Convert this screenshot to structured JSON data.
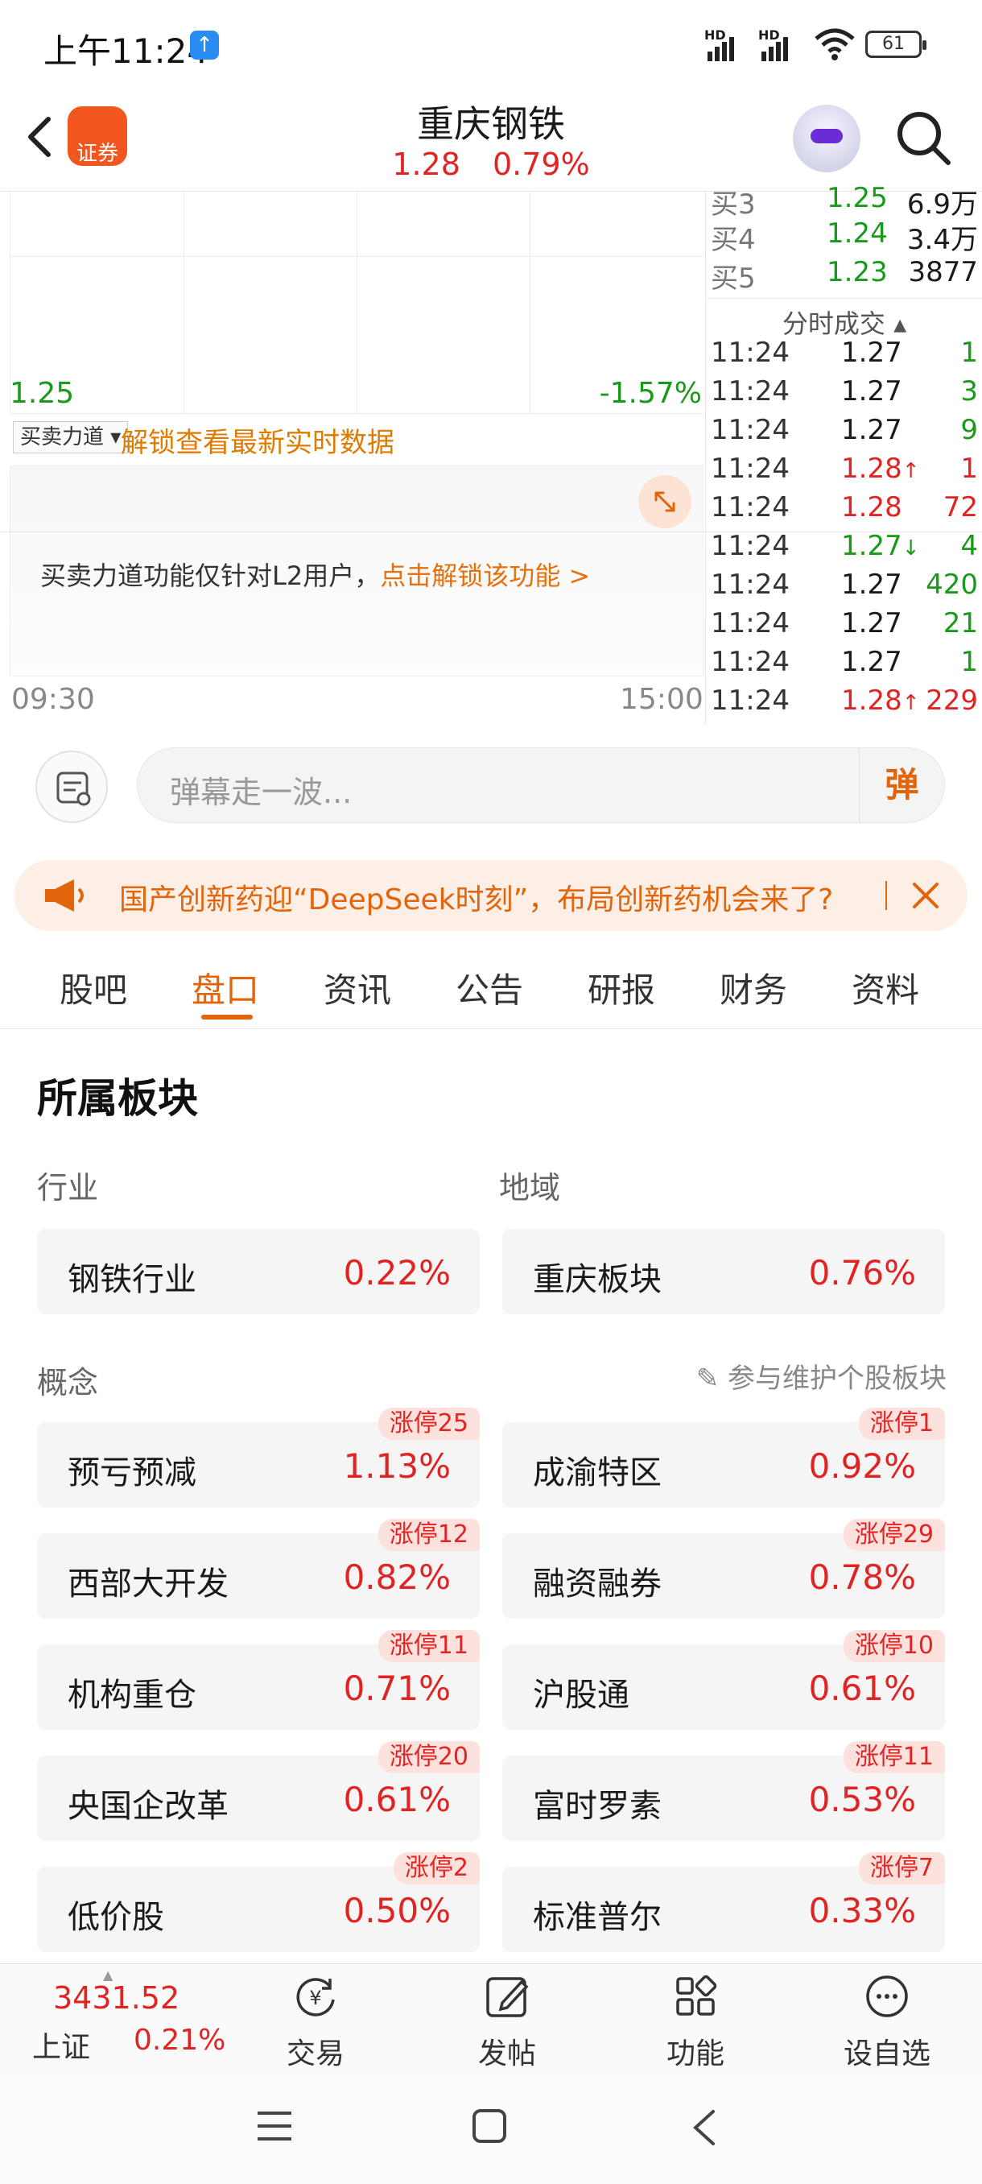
{
  "status_bar": {
    "time": "上午11:24",
    "battery": "61",
    "hd1": "HD",
    "hd2": "HD"
  },
  "header": {
    "title": "重庆钢铁",
    "price": "1.28",
    "change_pct": "0.79%",
    "logo_label": "证券"
  },
  "chart": {
    "low_price": "1.25",
    "low_pct": "-1.57%",
    "mm_select": "买卖力道",
    "unlock_link": "解锁查看最新实时数据",
    "mm_message_prefix": "买卖力道功能仅针对L2用户，",
    "mm_message_link": "点击解锁该功能 >",
    "time_start": "09:30",
    "time_end": "15:00"
  },
  "bids": [
    {
      "label": "买3",
      "price": "1.25",
      "vol": "6.9万"
    },
    {
      "label": "买4",
      "price": "1.24",
      "vol": "3.4万"
    },
    {
      "label": "买5",
      "price": "1.23",
      "vol": "3877"
    }
  ],
  "ticks_header": "分时成交",
  "ticks": [
    {
      "time": "11:24",
      "price": "1.27",
      "arrow": "",
      "vol": "1",
      "color": "green"
    },
    {
      "time": "11:24",
      "price": "1.27",
      "arrow": "",
      "vol": "3",
      "color": "green"
    },
    {
      "time": "11:24",
      "price": "1.27",
      "arrow": "",
      "vol": "9",
      "color": "green"
    },
    {
      "time": "11:24",
      "price": "1.28",
      "arrow": "↑",
      "vol": "1",
      "color": "red"
    },
    {
      "time": "11:24",
      "price": "1.28",
      "arrow": "",
      "vol": "72",
      "color": "red"
    },
    {
      "time": "11:24",
      "price": "1.27",
      "arrow": "↓",
      "vol": "4",
      "color": "green"
    },
    {
      "time": "11:24",
      "price": "1.27",
      "arrow": "",
      "vol": "420",
      "color": "green"
    },
    {
      "time": "11:24",
      "price": "1.27",
      "arrow": "",
      "vol": "21",
      "color": "green"
    },
    {
      "time": "11:24",
      "price": "1.27",
      "arrow": "",
      "vol": "1",
      "color": "green"
    },
    {
      "time": "11:24",
      "price": "1.28",
      "arrow": "↑",
      "vol": "229",
      "color": "red"
    }
  ],
  "danmu": {
    "placeholder": "弹幕走一波...",
    "button": "弹"
  },
  "banner": {
    "text": "国产创新药迎“DeepSeek时刻”，布局创新药机会来了?"
  },
  "tabs": [
    "股吧",
    "盘口",
    "资讯",
    "公告",
    "研报",
    "财务",
    "资料"
  ],
  "active_tab": "盘口",
  "sectors": {
    "title": "所属板块",
    "industry_label": "行业",
    "region_label": "地域",
    "industry": {
      "name": "钢铁行业",
      "pct": "0.22%"
    },
    "region": {
      "name": "重庆板块",
      "pct": "0.76%"
    },
    "concept_label": "概念",
    "maintain_link": "参与维护个股板块",
    "concepts": [
      {
        "name": "预亏预减",
        "pct": "1.13%",
        "badge": "涨停25"
      },
      {
        "name": "成渝特区",
        "pct": "0.92%",
        "badge": "涨停1"
      },
      {
        "name": "西部大开发",
        "pct": "0.82%",
        "badge": "涨停12"
      },
      {
        "name": "融资融券",
        "pct": "0.78%",
        "badge": "涨停29"
      },
      {
        "name": "机构重仓",
        "pct": "0.71%",
        "badge": "涨停11"
      },
      {
        "name": "沪股通",
        "pct": "0.61%",
        "badge": "涨停10"
      },
      {
        "name": "央国企改革",
        "pct": "0.61%",
        "badge": "涨停20"
      },
      {
        "name": "富时罗素",
        "pct": "0.53%",
        "badge": "涨停11"
      },
      {
        "name": "低价股",
        "pct": "0.50%",
        "badge": "涨停2"
      },
      {
        "name": "标准普尔",
        "pct": "0.33%",
        "badge": "涨停7"
      }
    ]
  },
  "bottom_nav": {
    "index_value": "3431.52",
    "index_name": "上证",
    "index_pct": "0.21%",
    "items": [
      "交易",
      "发帖",
      "功能",
      "设自选"
    ]
  }
}
